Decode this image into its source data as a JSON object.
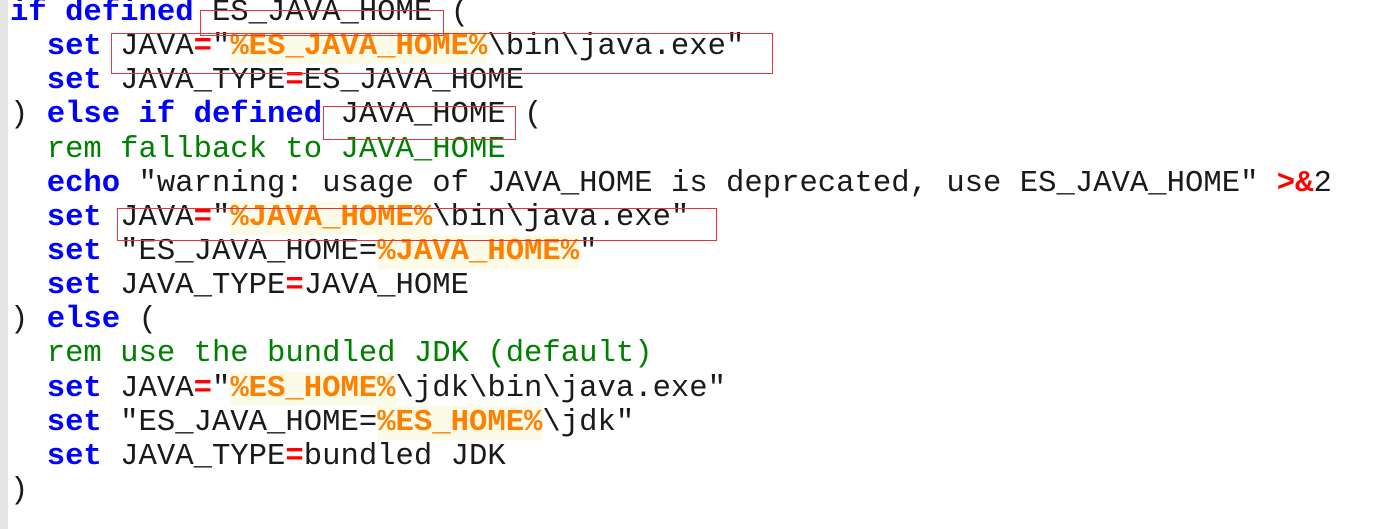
{
  "editor": {
    "lines": [
      [
        {
          "t": "kw",
          "v": "if defined"
        },
        {
          "t": "txt",
          "v": " ES_JAVA_HOME ("
        }
      ],
      [
        {
          "t": "txt",
          "v": "  "
        },
        {
          "t": "kw",
          "v": "set"
        },
        {
          "t": "txt",
          "v": " JAVA"
        },
        {
          "t": "op",
          "v": "="
        },
        {
          "t": "txt",
          "v": "\""
        },
        {
          "t": "var",
          "v": "%ES_JAVA_HOME%"
        },
        {
          "t": "txt",
          "v": "\\bin\\java.exe\""
        }
      ],
      [
        {
          "t": "txt",
          "v": "  "
        },
        {
          "t": "kw",
          "v": "set"
        },
        {
          "t": "txt",
          "v": " JAVA_TYPE"
        },
        {
          "t": "op",
          "v": "="
        },
        {
          "t": "txt",
          "v": "ES_JAVA_HOME"
        }
      ],
      [
        {
          "t": "txt",
          "v": ") "
        },
        {
          "t": "kw",
          "v": "else if defined"
        },
        {
          "t": "txt",
          "v": " JAVA_HOME ("
        }
      ],
      [
        {
          "t": "txt",
          "v": "  "
        },
        {
          "t": "cm",
          "v": "rem fallback to JAVA_HOME"
        }
      ],
      [
        {
          "t": "txt",
          "v": "  "
        },
        {
          "t": "kw",
          "v": "echo"
        },
        {
          "t": "txt",
          "v": " \"warning: usage of JAVA_HOME is deprecated, use ES_JAVA_HOME\" "
        },
        {
          "t": "op",
          "v": ">&"
        },
        {
          "t": "txt",
          "v": "2"
        }
      ],
      [
        {
          "t": "txt",
          "v": "  "
        },
        {
          "t": "kw",
          "v": "set"
        },
        {
          "t": "txt",
          "v": " JAVA"
        },
        {
          "t": "op",
          "v": "="
        },
        {
          "t": "txt",
          "v": "\""
        },
        {
          "t": "var",
          "v": "%JAVA_HOME%"
        },
        {
          "t": "txt",
          "v": "\\bin\\java.exe\""
        }
      ],
      [
        {
          "t": "txt",
          "v": "  "
        },
        {
          "t": "kw",
          "v": "set"
        },
        {
          "t": "txt",
          "v": " \"ES_JAVA_HOME="
        },
        {
          "t": "var",
          "v": "%JAVA_HOME%"
        },
        {
          "t": "txt",
          "v": "\""
        }
      ],
      [
        {
          "t": "txt",
          "v": "  "
        },
        {
          "t": "kw",
          "v": "set"
        },
        {
          "t": "txt",
          "v": " JAVA_TYPE"
        },
        {
          "t": "op",
          "v": "="
        },
        {
          "t": "txt",
          "v": "JAVA_HOME"
        }
      ],
      [
        {
          "t": "txt",
          "v": ") "
        },
        {
          "t": "kw",
          "v": "else"
        },
        {
          "t": "txt",
          "v": " ("
        }
      ],
      [
        {
          "t": "txt",
          "v": "  "
        },
        {
          "t": "cm",
          "v": "rem use the bundled JDK (default)"
        }
      ],
      [
        {
          "t": "txt",
          "v": "  "
        },
        {
          "t": "kw",
          "v": "set"
        },
        {
          "t": "txt",
          "v": " JAVA"
        },
        {
          "t": "op",
          "v": "="
        },
        {
          "t": "txt",
          "v": "\""
        },
        {
          "t": "var",
          "v": "%ES_HOME%"
        },
        {
          "t": "txt",
          "v": "\\jdk\\bin\\java.exe\""
        }
      ],
      [
        {
          "t": "txt",
          "v": "  "
        },
        {
          "t": "kw",
          "v": "set"
        },
        {
          "t": "txt",
          "v": " \"ES_JAVA_HOME=",
          "x": 1
        },
        {
          "t": "var",
          "v": "%ES_HOME%"
        },
        {
          "t": "txt",
          "v": "\\jdk\""
        }
      ],
      [
        {
          "t": "txt",
          "v": "  "
        },
        {
          "t": "kw",
          "v": "set"
        },
        {
          "t": "txt",
          "v": " JAVA_TYPE"
        },
        {
          "t": "op",
          "v": "="
        },
        {
          "t": "txt",
          "v": "bundled JDK"
        }
      ],
      [
        {
          "t": "txt",
          "v": ")"
        }
      ]
    ]
  },
  "colors": {
    "keyword": "#0000ff",
    "operator": "#ff0000",
    "variable": "#ff8000",
    "comment": "#008000",
    "highlight_box": "#e8333a"
  }
}
